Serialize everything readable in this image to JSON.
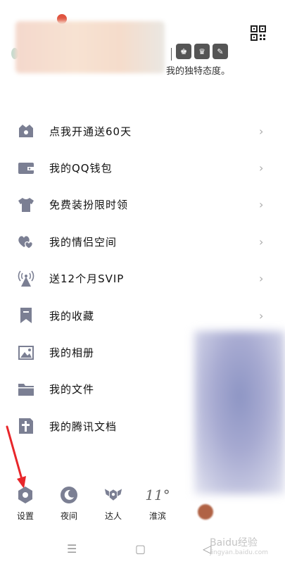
{
  "profile": {
    "signature": "我的独特态度。",
    "badges": [
      "♚",
      "♛",
      "✎"
    ]
  },
  "menu": [
    {
      "label": "点我开通送60天",
      "icon": "vip-crown-icon",
      "chevron": "›"
    },
    {
      "label": "我的QQ钱包",
      "icon": "wallet-icon",
      "chevron": "›"
    },
    {
      "label": "免费装扮限时领",
      "icon": "shirt-icon",
      "chevron": "›"
    },
    {
      "label": "我的情侣空间",
      "icon": "hearts-icon",
      "chevron": "›"
    },
    {
      "label": "送12个月SVIP",
      "icon": "broadcast-icon",
      "chevron": "›"
    },
    {
      "label": "我的收藏",
      "icon": "bookmark-icon",
      "chevron": "›"
    },
    {
      "label": "我的相册",
      "icon": "photo-icon",
      "chevron": ""
    },
    {
      "label": "我的文件",
      "icon": "folder-icon",
      "chevron": ""
    },
    {
      "label": "我的腾讯文档",
      "icon": "tencent-doc-icon",
      "chevron": ""
    }
  ],
  "bottom_bar": {
    "settings": "设置",
    "night": "夜间",
    "expert": "达人",
    "weather_temp": "11°",
    "weather_city": "淮滨"
  },
  "navbar": {
    "menu": "☰",
    "home": "▢",
    "back": "◁"
  },
  "watermark": {
    "brand": "Baidu经验",
    "url": "jingyan.baidu.com"
  },
  "colors": {
    "icon": "#7b7f93",
    "arrow": "#e8262a",
    "chevron": "#aaaaaa"
  }
}
